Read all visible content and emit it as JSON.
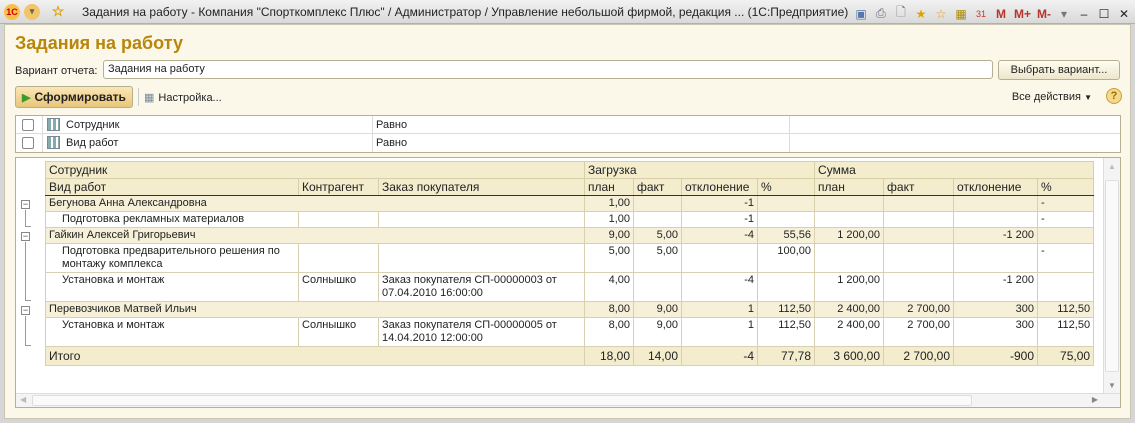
{
  "window": {
    "title": "Задания на работу - Компания \"Спорткомплекс Плюс\" / Администратор /  Управление небольшой фирмой, редакция ...  (1С:Предприятие)",
    "toolbar_right": [
      "M",
      "M+",
      "M-"
    ]
  },
  "page": {
    "title": "Задания на работу"
  },
  "variant": {
    "label": "Вариант отчета:",
    "value": "Задания на работу",
    "choose_button": "Выбрать вариант..."
  },
  "toolbar": {
    "generate": "Сформировать",
    "settings": "Настройка...",
    "all_actions": "Все действия",
    "help": "?"
  },
  "filters": [
    {
      "name": "Сотрудник",
      "condition": "Равно",
      "checked": false
    },
    {
      "name": "Вид работ",
      "condition": "Равно",
      "checked": false
    }
  ],
  "report": {
    "headers": {
      "employee": "Сотрудник",
      "work_type": "Вид работ",
      "counterparty": "Контрагент",
      "order": "Заказ покупателя",
      "load": "Загрузка",
      "sum": "Сумма",
      "plan": "план",
      "fact": "факт",
      "deviation": "отклонение",
      "pct": "%"
    },
    "rows": [
      {
        "type": "group",
        "name": "Бегунова Анна Александровна",
        "values": [
          "1,00",
          "",
          "-1",
          "",
          "",
          "",
          "",
          "-"
        ]
      },
      {
        "type": "item",
        "name": "Подготовка рекламных материалов",
        "counterparty": "",
        "order": "",
        "values": [
          "1,00",
          "",
          "-1",
          "",
          "",
          "",
          "",
          "-"
        ]
      },
      {
        "type": "group",
        "name": "Гайкин Алексей Григорьевич",
        "values": [
          "9,00",
          "5,00",
          "-4",
          "55,56",
          "1 200,00",
          "",
          "-1 200",
          ""
        ]
      },
      {
        "type": "item",
        "name": "Подготовка предварительного решения по монтажу комплекса",
        "counterparty": "",
        "order": "",
        "values": [
          "5,00",
          "5,00",
          "",
          "100,00",
          "",
          "",
          "",
          "-"
        ]
      },
      {
        "type": "item",
        "name": "Установка и монтаж",
        "counterparty": "Солнышко",
        "order": "Заказ покупателя СП-00000003 от 07.04.2010 16:00:00",
        "values": [
          "4,00",
          "",
          "-4",
          "",
          "1 200,00",
          "",
          "-1 200",
          ""
        ]
      },
      {
        "type": "group",
        "name": "Перевозчиков Матвей Ильич",
        "values": [
          "8,00",
          "9,00",
          "1",
          "112,50",
          "2 400,00",
          "2 700,00",
          "300",
          "112,50"
        ]
      },
      {
        "type": "item",
        "name": "Установка и монтаж",
        "counterparty": "Солнышко",
        "order": "Заказ покупателя СП-00000005 от 14.04.2010 12:00:00",
        "values": [
          "8,00",
          "9,00",
          "1",
          "112,50",
          "2 400,00",
          "2 700,00",
          "300",
          "112,50"
        ]
      }
    ],
    "total": {
      "name": "Итого",
      "values": [
        "18,00",
        "14,00",
        "-4",
        "77,78",
        "3 600,00",
        "2 700,00",
        "-900",
        "75,00"
      ]
    }
  }
}
